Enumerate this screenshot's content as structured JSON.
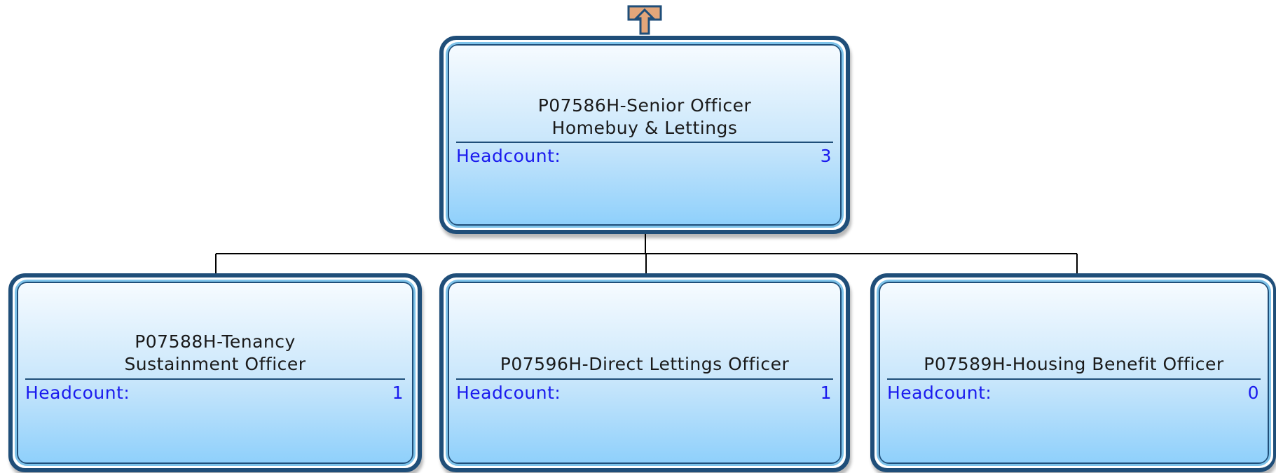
{
  "chart": {
    "up_button_color": "#e3a67a",
    "frame_color": "#1f4e79",
    "headcount_color": "#1a1aee",
    "root": {
      "title": "P07586H-Senior Officer Homebuy & Lettings",
      "headcount_label": "Headcount:",
      "headcount_value": "3"
    },
    "children": [
      {
        "title": "P07588H-Tenancy Sustainment Officer",
        "headcount_label": "Headcount:",
        "headcount_value": "1"
      },
      {
        "title": "P07596H-Direct Lettings Officer",
        "headcount_label": "Headcount:",
        "headcount_value": "1"
      },
      {
        "title": "P07589H-Housing Benefit Officer",
        "headcount_label": "Headcount:",
        "headcount_value": "0"
      }
    ]
  }
}
